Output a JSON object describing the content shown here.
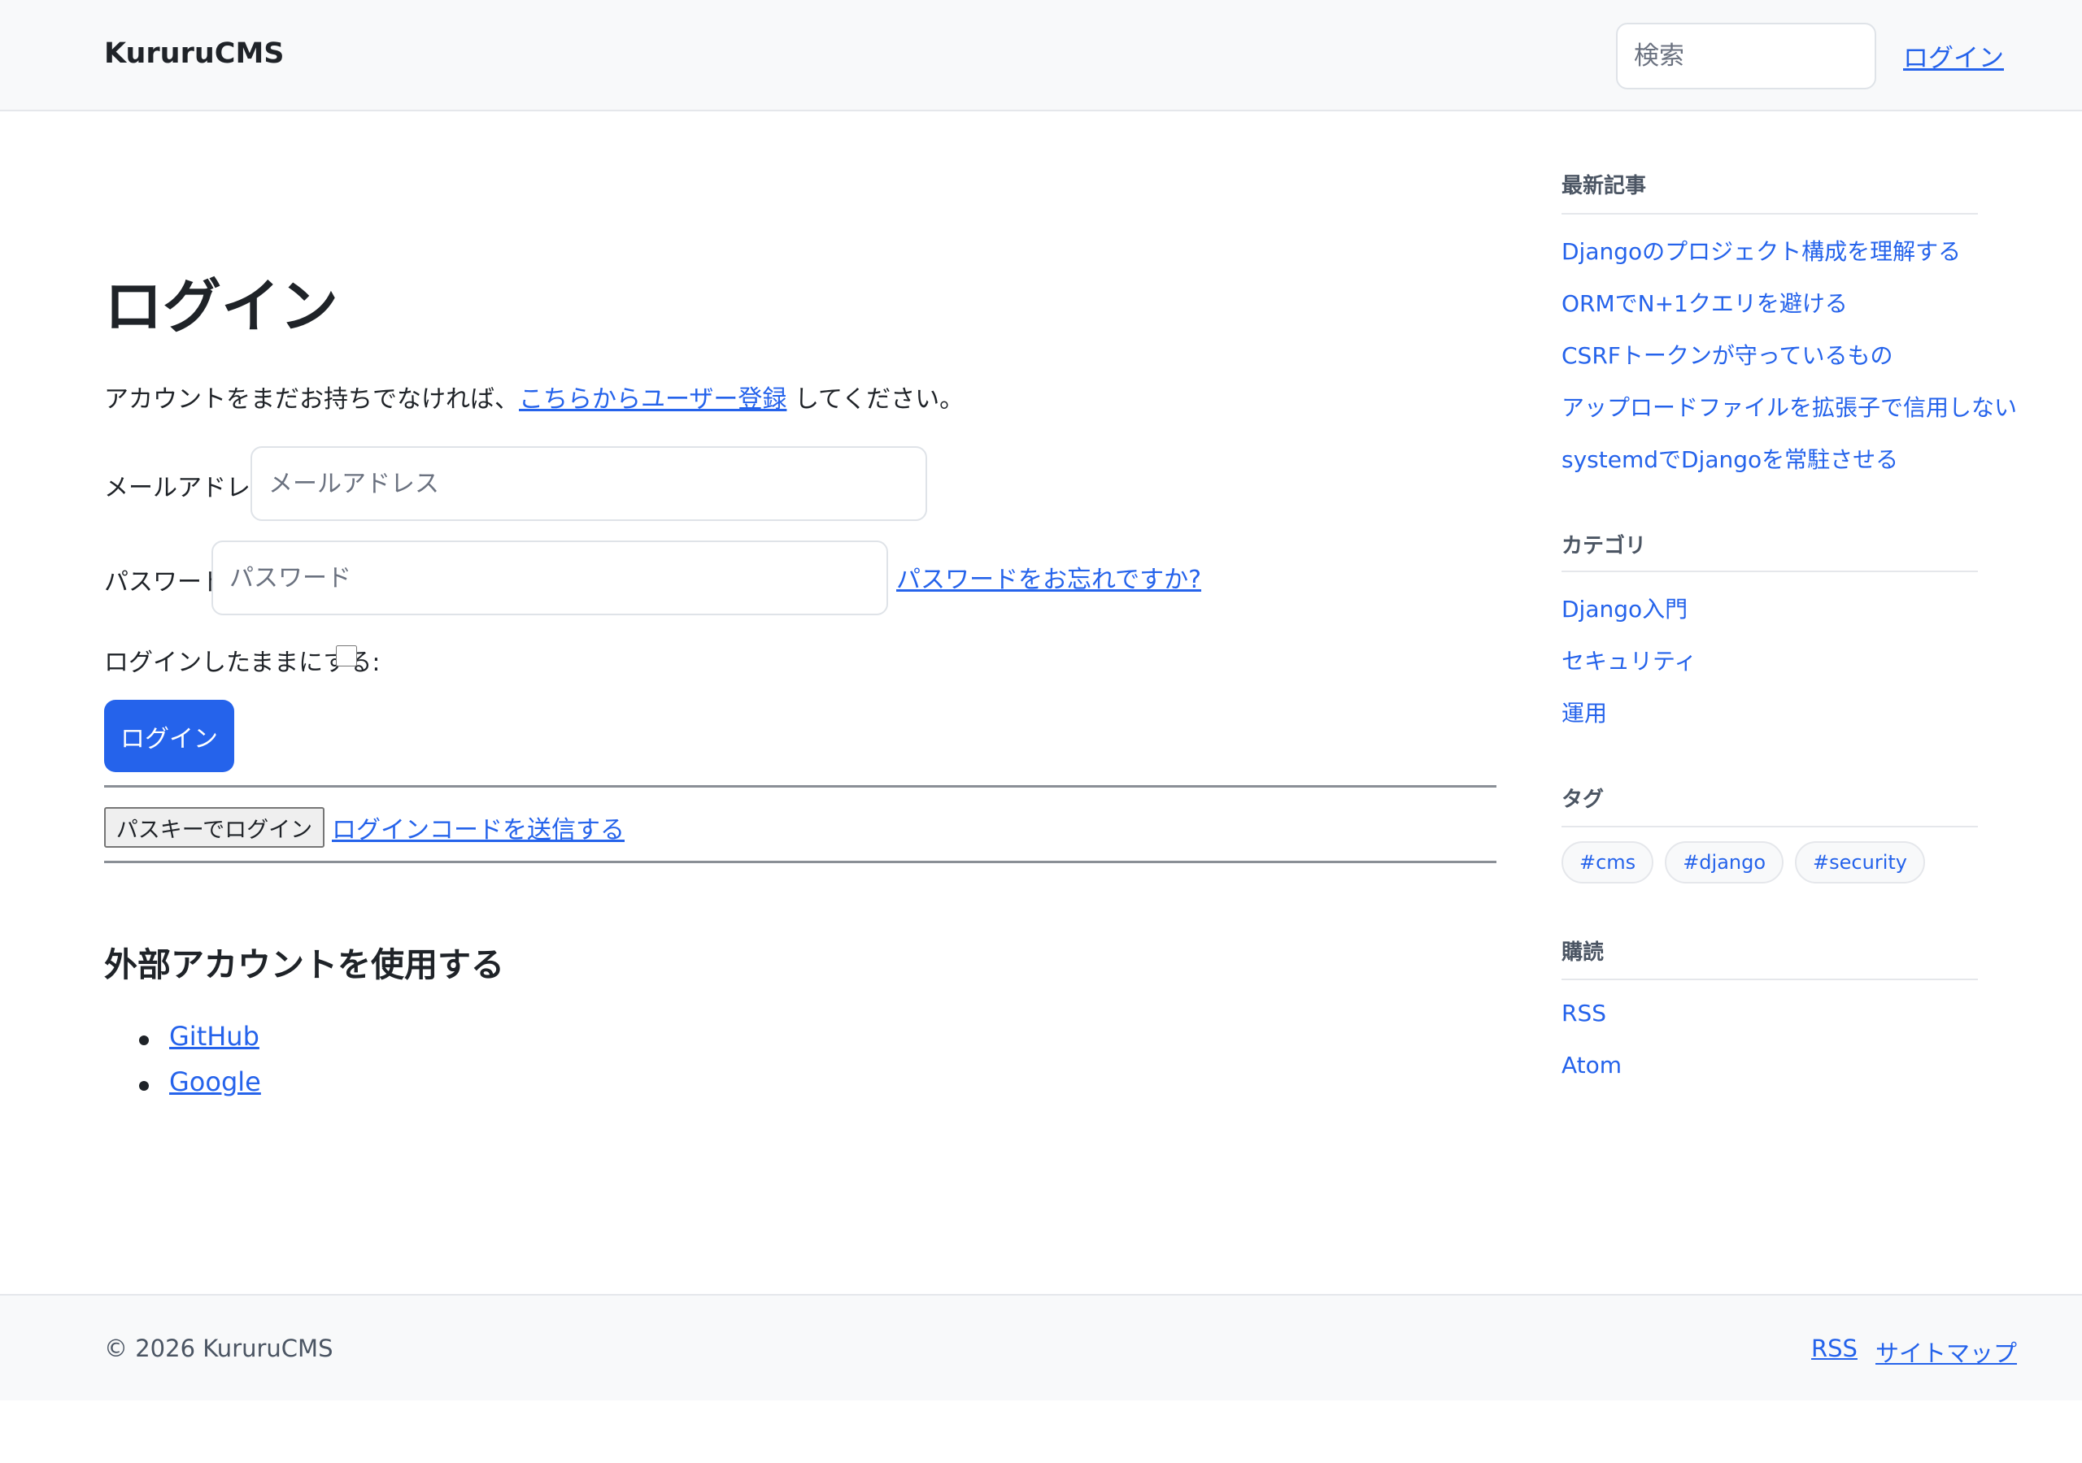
{
  "header": {
    "brand": "KururuCMS",
    "search_placeholder": "検索",
    "login_link": "ログイン"
  },
  "main": {
    "title": "ログイン",
    "intro_text": "アカウントをまだお持ちでなければ、",
    "signup_link": "こちらからユーザー登録",
    "intro_suffix": " してください。",
    "email_label": "メールアドレス:",
    "email_placeholder": "メールアドレス",
    "password_label": "パスワード:",
    "password_placeholder": "パスワード",
    "forgot_link": "パスワードをお忘れですか?",
    "remember_label": "ログインしたままにする:",
    "remember_checked": false,
    "login_button": "ログイン",
    "passkey_button": "パスキーでログイン",
    "send_code_link": "ログインコードを送信する",
    "external_title": "外部アカウントを使用する",
    "providers": [
      "GitHub",
      "Google"
    ]
  },
  "sidebar": {
    "recent": {
      "heading": "最新記事",
      "items": [
        "Djangoのプロジェクト構成を理解する",
        "ORMでN+1クエリを避ける",
        "CSRFトークンが守っているもの",
        "アップロードファイルを拡張子で信用しない",
        "systemdでDjangoを常駐させる"
      ]
    },
    "categories": {
      "heading": "カテゴリ",
      "items": [
        "Django入門",
        "セキュリティ",
        "運用"
      ]
    },
    "tags": {
      "heading": "タグ",
      "items": [
        "#cms",
        "#django",
        "#security"
      ]
    },
    "subscribe": {
      "heading": "購読",
      "items": [
        "RSS",
        "Atom"
      ]
    }
  },
  "footer": {
    "copyright": "© 2026 KururuCMS",
    "rss_link": "RSS",
    "sitemap_link": "サイトマップ"
  },
  "colors": {
    "accent": "#2563eb",
    "header_bg": "#f8f9fa",
    "text": "#1f2328"
  }
}
